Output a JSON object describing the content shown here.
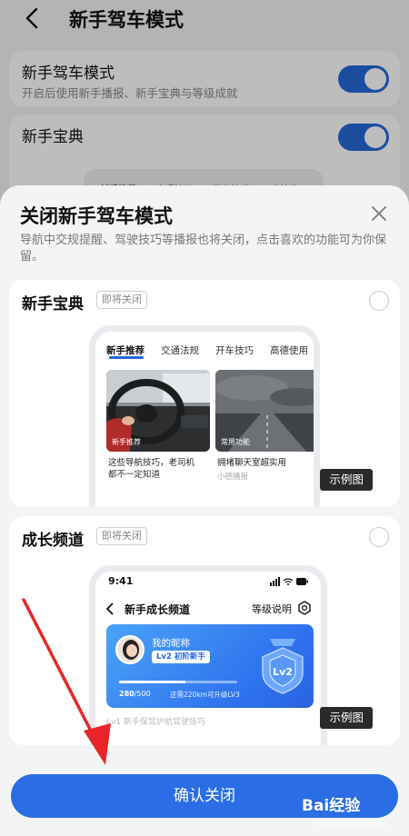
{
  "page": {
    "title": "新手驾车模式"
  },
  "settings": [
    {
      "title": "新手驾车模式",
      "subtitle": "开启后使用新手播报、新手宝典与等级成就",
      "enabled": true
    },
    {
      "title": "新手宝典",
      "enabled": true
    }
  ],
  "peek_tabs": [
    "新手推荐",
    "交通法规",
    "开车技巧",
    "高德使用"
  ],
  "sheet": {
    "title": "关闭新手驾车模式",
    "description": "导航中交规提醒、驾驶技巧等播报也将关闭，点击喜欢的功能可为你保留。",
    "features": [
      {
        "title": "新手宝典",
        "badge": "即将关闭",
        "example_label": "示例图",
        "selected": false,
        "preview": {
          "tabs": [
            "新手推荐",
            "交通法规",
            "开车技巧",
            "高德使用"
          ],
          "active_tab": 0,
          "items": [
            {
              "tag": "新手推荐",
              "caption": "这些导航技巧，老司机",
              "sub": "都不一定知道"
            },
            {
              "tag": "常用功能",
              "caption": "拥堵聊天室超实用",
              "sub": "小德播报"
            }
          ]
        }
      },
      {
        "title": "成长频道",
        "badge": "即将关闭",
        "example_label": "示例图",
        "selected": false,
        "preview": {
          "time": "9:41",
          "title": "新手成长频道",
          "level_link": "等级说明",
          "nickname": "我的昵称",
          "level_tag": "Lv2 初阶新手",
          "progress_value": "280",
          "progress_total": "/500",
          "progress_fraction": 0.56,
          "progress_note": "还需220km可升级LV3",
          "badge_text": "Lv2",
          "blurred_text": "Lv1 新手保驾护航驾驶技巧"
        }
      }
    ],
    "confirm_label": "确认关闭"
  },
  "watermark": {
    "brand": "Bai经验",
    "url": "jingyan.baidu.com"
  },
  "colors": {
    "accent": "#2a6de4",
    "toggle": "#2767d8"
  }
}
